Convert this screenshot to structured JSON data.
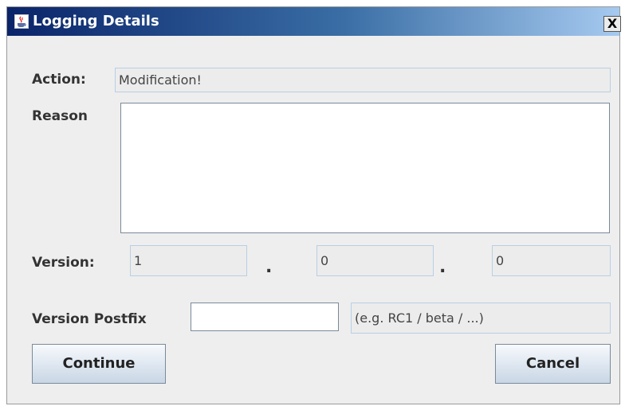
{
  "window": {
    "title": "Logging Details",
    "close_glyph": "X",
    "icon": "java-cup-icon"
  },
  "action": {
    "label": "Action:",
    "value": "Modification!"
  },
  "reason": {
    "label": "Reason",
    "value": ""
  },
  "version": {
    "label": "Version:",
    "major": "1",
    "minor": "0",
    "patch": "0",
    "separator": "."
  },
  "postfix": {
    "label": "Version Postfix",
    "value": "",
    "hint": "(e.g. RC1 / beta / ...)"
  },
  "buttons": {
    "continue": "Continue",
    "cancel": "Cancel"
  }
}
